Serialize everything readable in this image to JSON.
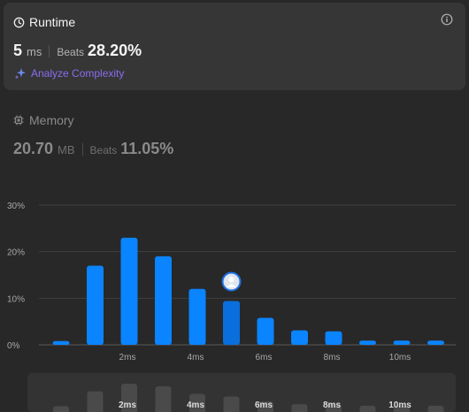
{
  "runtime": {
    "title": "Runtime",
    "value": "5",
    "unit": "ms",
    "beats_label": "Beats",
    "beats_value": "28.20%",
    "analyze_label": "Analyze Complexity"
  },
  "memory": {
    "title": "Memory",
    "value": "20.70",
    "unit": "MB",
    "beats_label": "Beats",
    "beats_value": "11.05%"
  },
  "colors": {
    "bar": "#0a84ff",
    "bar_highlight": "#0a6fdc",
    "accent_purple": "#8b6cf0",
    "scrubber_bar": "#4a4a4a"
  },
  "chart_data": {
    "type": "bar",
    "ylim": [
      0,
      30
    ],
    "yticks": [
      "0%",
      "10%",
      "20%",
      "30%"
    ],
    "xtick_labels": [
      "2ms",
      "4ms",
      "6ms",
      "8ms",
      "10ms"
    ],
    "xtick_bar_index": [
      2,
      4,
      6,
      8,
      10
    ],
    "values": [
      0.8,
      17,
      23,
      19,
      12,
      9.4,
      5.8,
      3.1,
      2.9,
      0.9,
      0.9,
      0.9
    ],
    "highlight_index": 5,
    "scrubber_values": [
      1,
      30,
      45,
      40,
      25,
      20,
      10,
      5,
      5,
      2,
      2,
      2
    ]
  }
}
